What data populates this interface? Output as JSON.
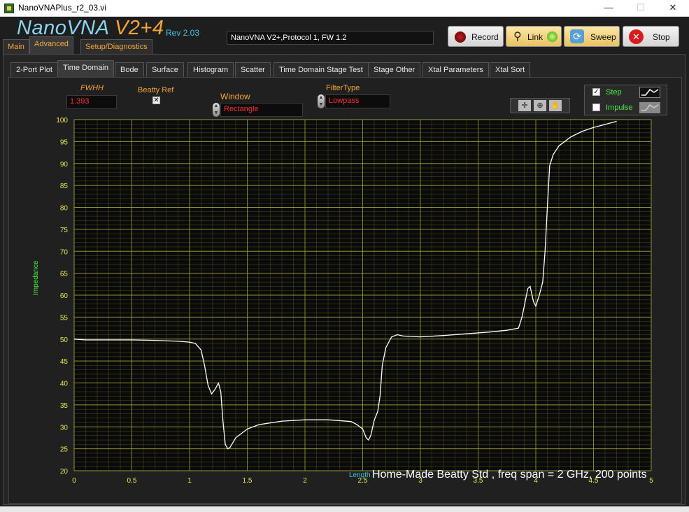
{
  "window": {
    "title": "NanoVNAPlus_r2_03.vi",
    "minimize": "—",
    "maximize": "☐",
    "close": "✕"
  },
  "header": {
    "brand_main": "NanoVNA ",
    "brand_v": "V2+4",
    "rev": "Rev 2.03",
    "device_info": "NanoVNA V2+,Protocol 1, FW 1.2",
    "buttons": {
      "record": "Record",
      "link": "Link",
      "sweep": "Sweep",
      "stop": "Stop"
    }
  },
  "main_tabs": [
    "Main",
    "Advanced",
    "Setup/Diagnostics"
  ],
  "sub_tabs": [
    "2-Port Plot",
    "Time Domain",
    "Bode",
    "Surface",
    "Histogram",
    "Scatter",
    "Time Domain Stage Test",
    "Stage Other",
    "Xtal Parameters",
    "Xtal Sort"
  ],
  "controls": {
    "fwhh_label": "FWHH",
    "fwhh_value": "1.393",
    "beatty_label": "Beatty Ref",
    "beatty_checked": "✕",
    "window_label": "Window",
    "window_value": "Rectangle",
    "filter_label": "FilterType",
    "filter_value": "Lowpass",
    "legend_step": "Step",
    "legend_impulse": "Impulse",
    "step_checked": "✓"
  },
  "colors": {
    "trace": "#ffffff",
    "grid": "#9a9a3a",
    "plot_bg": "#0a0a0a",
    "ticks": "#e8e84a",
    "accent": "#f4a63a"
  },
  "caption": "Home-Made Beatty Std , freq span = 2 GHz, 200 points",
  "chart_data": {
    "type": "line",
    "xlabel": "Length",
    "ylabel": "Impedance",
    "xlim": [
      0,
      5
    ],
    "ylim": [
      20,
      100
    ],
    "xticks": [
      "0",
      "0.5",
      "1",
      "1.5",
      "2",
      "2.5",
      "3",
      "3.5",
      "4",
      "4.5",
      "5"
    ],
    "yticks": [
      "20",
      "25",
      "30",
      "35",
      "40",
      "45",
      "50",
      "55",
      "60",
      "65",
      "70",
      "75",
      "80",
      "85",
      "90",
      "95",
      "100"
    ],
    "grid": true,
    "series": [
      {
        "name": "Step",
        "x": [
          0,
          0.1,
          0.3,
          0.5,
          0.7,
          0.9,
          1.0,
          1.05,
          1.1,
          1.13,
          1.16,
          1.19,
          1.22,
          1.25,
          1.27,
          1.29,
          1.31,
          1.33,
          1.35,
          1.4,
          1.5,
          1.6,
          1.8,
          2.0,
          2.2,
          2.4,
          2.45,
          2.5,
          2.53,
          2.55,
          2.57,
          2.6,
          2.63,
          2.65,
          2.67,
          2.7,
          2.75,
          2.8,
          2.85,
          3.0,
          3.2,
          3.4,
          3.6,
          3.75,
          3.85,
          3.88,
          3.9,
          3.93,
          3.95,
          3.98,
          4.0,
          4.03,
          4.06,
          4.08,
          4.1,
          4.12,
          4.15,
          4.2,
          4.3,
          4.4,
          4.5,
          4.6,
          4.7
        ],
        "y": [
          50,
          49.8,
          49.8,
          49.8,
          49.7,
          49.5,
          49.3,
          49.0,
          47.5,
          44.0,
          39.5,
          37.5,
          38.5,
          40.0,
          38.0,
          31.0,
          26.0,
          25.0,
          25.3,
          27.5,
          29.5,
          30.5,
          31.3,
          31.6,
          31.6,
          31.2,
          30.5,
          29.5,
          27.5,
          27.0,
          28.0,
          31.5,
          33.5,
          37.0,
          44.0,
          48.0,
          50.5,
          51.0,
          50.7,
          50.5,
          50.8,
          51.2,
          51.6,
          52.0,
          52.5,
          55.0,
          57.5,
          61.5,
          62.0,
          58.5,
          57.5,
          60.0,
          63.0,
          70.0,
          80.0,
          89.5,
          92.0,
          94.0,
          96.0,
          97.3,
          98.2,
          98.9,
          99.6
        ]
      }
    ]
  }
}
